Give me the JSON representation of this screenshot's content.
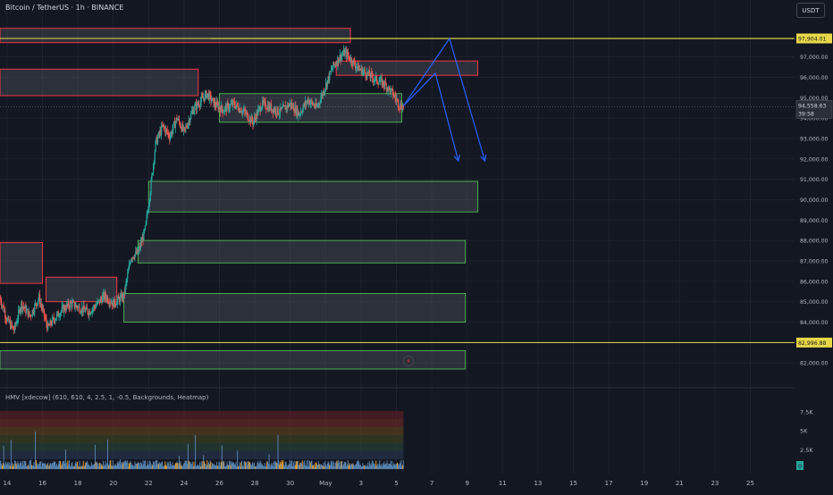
{
  "header": {
    "title": "Bitcoin / TetherUS · 1h · BINANCE",
    "currency_button": "USDT"
  },
  "indicator": {
    "title": "HMV [xdecow] (610, 610, 4, 2.5, 1, -0.5, Backgrounds, Heatmap)",
    "axis_labels": [
      "7.5K",
      "5K",
      "2.5K"
    ],
    "current_value": "0"
  },
  "colors": {
    "background": "#131722",
    "grid": "#1e222d",
    "up": "#26a69a",
    "down": "#ef5350",
    "supply_zone_border": "#f23645",
    "demand_zone_border": "#4caf50",
    "horizontal_line": "#e8d847",
    "projection_arrow": "#2962ff",
    "price_label": "#2a2e39"
  },
  "chart_data": {
    "type": "candlestick",
    "symbol": "BTCUSDT",
    "exchange": "BINANCE",
    "interval": "1h",
    "y_ticks": [
      97000,
      96000,
      95000,
      94000,
      93000,
      92000,
      91000,
      90000,
      89000,
      88000,
      87000,
      86000,
      85000,
      84000,
      83000,
      82000
    ],
    "y_tick_labels": [
      "97,000.00",
      "96,000.00",
      "95,000.00",
      "94,000.00",
      "93,000.00",
      "92,000.00",
      "91,000.00",
      "90,000.00",
      "89,000.00",
      "88,000.00",
      "87,000.00",
      "86,000.00",
      "85,000.00",
      "84,000.00",
      "83,000.00",
      "82,000.00"
    ],
    "ylim": [
      81700,
      99000
    ],
    "x_ticks": [
      {
        "label": "14",
        "day": 14
      },
      {
        "label": "16",
        "day": 16
      },
      {
        "label": "18",
        "day": 18
      },
      {
        "label": "20",
        "day": 20
      },
      {
        "label": "22",
        "day": 22
      },
      {
        "label": "24",
        "day": 24
      },
      {
        "label": "26",
        "day": 26
      },
      {
        "label": "28",
        "day": 28
      },
      {
        "label": "30",
        "day": 30
      },
      {
        "label": "May",
        "day": 32
      },
      {
        "label": "3",
        "day": 34
      },
      {
        "label": "5",
        "day": 36
      },
      {
        "label": "7",
        "day": 38
      },
      {
        "label": "9",
        "day": 40
      },
      {
        "label": "11",
        "day": 42
      },
      {
        "label": "13",
        "day": 44
      },
      {
        "label": "15",
        "day": 46
      },
      {
        "label": "17",
        "day": 48
      },
      {
        "label": "19",
        "day": 50
      },
      {
        "label": "21",
        "day": 52
      },
      {
        "label": "23",
        "day": 54
      },
      {
        "label": "25",
        "day": 56
      }
    ],
    "xlim": [
      13.6,
      58.5
    ],
    "price_path": [
      [
        13.6,
        85200
      ],
      [
        14.0,
        84100
      ],
      [
        14.4,
        83600
      ],
      [
        14.8,
        84900
      ],
      [
        15.3,
        84300
      ],
      [
        15.8,
        85200
      ],
      [
        16.3,
        83700
      ],
      [
        16.6,
        84100
      ],
      [
        17.1,
        84600
      ],
      [
        17.6,
        84900
      ],
      [
        18.1,
        84700
      ],
      [
        18.6,
        84500
      ],
      [
        19.0,
        84800
      ],
      [
        19.5,
        85300
      ],
      [
        20.0,
        84900
      ],
      [
        20.6,
        85300
      ],
      [
        21.0,
        87200
      ],
      [
        21.4,
        87400
      ],
      [
        21.8,
        88500
      ],
      [
        22.1,
        90500
      ],
      [
        22.4,
        92800
      ],
      [
        22.8,
        93600
      ],
      [
        23.2,
        93100
      ],
      [
        23.6,
        94000
      ],
      [
        24.0,
        93300
      ],
      [
        24.5,
        94400
      ],
      [
        24.9,
        94800
      ],
      [
        25.3,
        95200
      ],
      [
        25.7,
        94700
      ],
      [
        26.2,
        94400
      ],
      [
        26.8,
        94700
      ],
      [
        27.4,
        94300
      ],
      [
        27.9,
        93800
      ],
      [
        28.4,
        94700
      ],
      [
        28.9,
        94500
      ],
      [
        29.4,
        94300
      ],
      [
        30.0,
        94700
      ],
      [
        30.5,
        94200
      ],
      [
        31.0,
        94900
      ],
      [
        31.5,
        94500
      ],
      [
        32.0,
        95600
      ],
      [
        32.4,
        96500
      ],
      [
        32.8,
        97000
      ],
      [
        33.1,
        97200
      ],
      [
        33.5,
        96800
      ],
      [
        33.9,
        96400
      ],
      [
        34.3,
        96200
      ],
      [
        34.8,
        95900
      ],
      [
        35.3,
        95700
      ],
      [
        35.8,
        95200
      ],
      [
        36.2,
        94600
      ],
      [
        36.4,
        94558
      ]
    ],
    "last_price": 94558.63,
    "last_price_label": "94,558.63",
    "countdown": "39:58",
    "horizontal_lines": [
      {
        "value": 97904.01,
        "label": "97,904.01"
      },
      {
        "value": 82996.88,
        "label": "82,996.88"
      }
    ],
    "supply_zones": [
      {
        "x0": 13.6,
        "x1": 33.4,
        "top": 98400,
        "bottom": 97700
      },
      {
        "x0": 13.6,
        "x1": 24.8,
        "top": 96400,
        "bottom": 95100
      },
      {
        "x0": 13.6,
        "x1": 16.0,
        "top": 87900,
        "bottom": 85900
      },
      {
        "x0": 16.2,
        "x1": 20.2,
        "top": 86200,
        "bottom": 85000
      },
      {
        "x0": 32.6,
        "x1": 40.6,
        "top": 96800,
        "bottom": 96100
      }
    ],
    "demand_zones": [
      {
        "x0": 26.0,
        "x1": 36.3,
        "top": 95200,
        "bottom": 93800
      },
      {
        "x0": 22.0,
        "x1": 40.6,
        "top": 90900,
        "bottom": 89400
      },
      {
        "x0": 21.4,
        "x1": 39.9,
        "top": 88000,
        "bottom": 86900
      },
      {
        "x0": 20.6,
        "x1": 39.9,
        "top": 85400,
        "bottom": 84000
      },
      {
        "x0": 13.6,
        "x1": 39.9,
        "top": 82600,
        "bottom": 81700
      }
    ],
    "projection_paths": [
      [
        [
          36.4,
          94600
        ],
        [
          38.2,
          96200
        ],
        [
          39.5,
          91900
        ]
      ],
      [
        [
          36.4,
          94600
        ],
        [
          39.0,
          97900
        ],
        [
          41.0,
          91900
        ]
      ]
    ],
    "volume_axis": {
      "labels": [
        "7.5K",
        "5K",
        "2.5K"
      ],
      "values": [
        7500,
        5000,
        2500
      ],
      "max": 9000
    },
    "volume_heatmap_bands": [
      "#6b1f24",
      "#7a2e22",
      "#6b4a1c",
      "#4a4a20",
      "#2c4a3a",
      "#2a3a55"
    ]
  }
}
